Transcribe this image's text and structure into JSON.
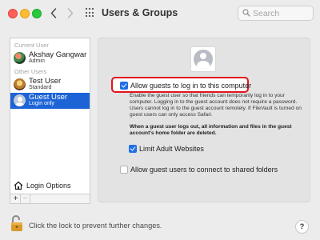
{
  "window": {
    "title": "Users & Groups"
  },
  "search": {
    "placeholder": "Search"
  },
  "sidebar": {
    "current_user_label": "Current User",
    "other_users_label": "Other Users",
    "users": [
      {
        "name": "Akshay Gangwar",
        "role": "Admin",
        "avatar": "akshay-avatar",
        "selected": false
      },
      {
        "name": "Test User",
        "role": "Standard",
        "avatar": "test-avatar",
        "selected": false
      },
      {
        "name": "Guest User",
        "role": "Login only",
        "avatar": "guest-avatar",
        "selected": true
      }
    ],
    "login_options_label": "Login Options",
    "add_label": "+",
    "remove_label": "−"
  },
  "main": {
    "allow_guests": {
      "label": "Allow guests to log in to this computer",
      "checked": true
    },
    "description": "Enable the guest user so that friends can temporarily log in to your computer. Logging in to the guest account does not require a password. Users cannot log in to the guest account remotely. If FileVault is turned on guest users can only access Safari.",
    "logout_warning": "When a guest user logs out, all information and files in the guest account's home folder are deleted.",
    "limit_adult": {
      "label": "Limit Adult Websites",
      "checked": true
    },
    "shared_folders": {
      "label": "Allow guest users to connect to shared folders",
      "checked": false
    }
  },
  "footer": {
    "lock_text": "Click the lock to prevent further changes.",
    "help_label": "?"
  },
  "colors": {
    "accent": "#1f6fe5",
    "selection": "#1c64d6",
    "highlight_outline": "#e2141b"
  }
}
